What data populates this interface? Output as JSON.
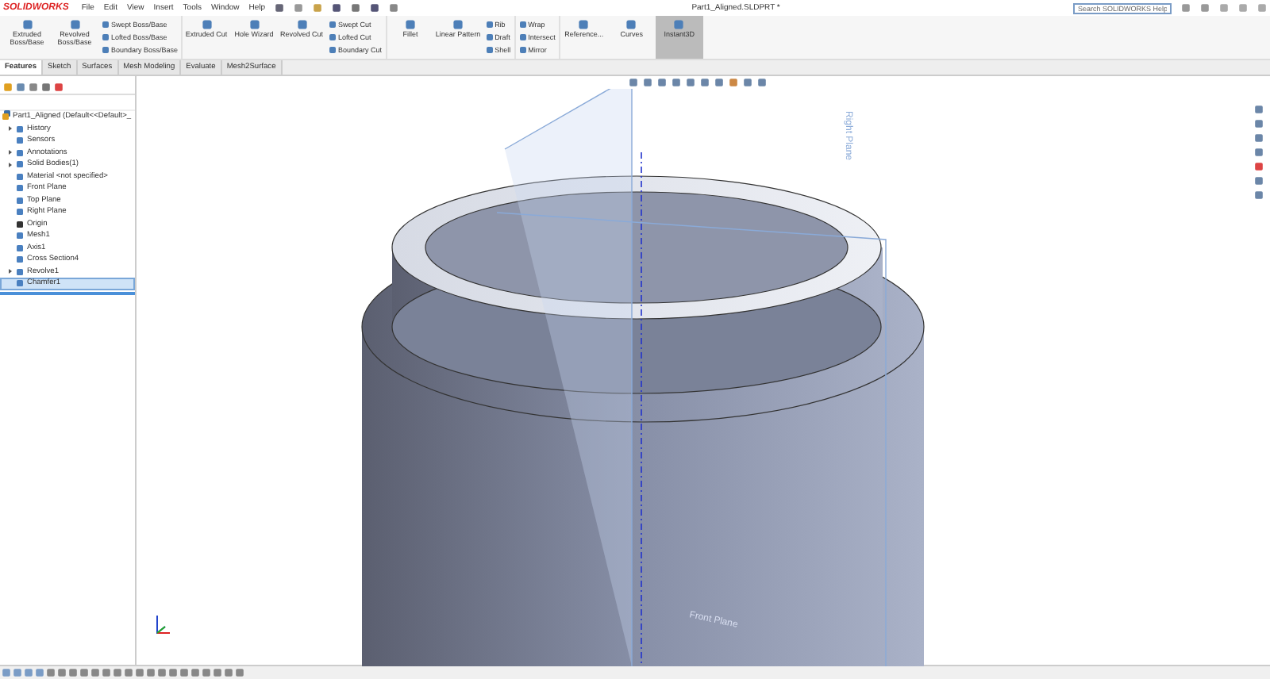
{
  "app": {
    "logo": "SOLIDWORKS"
  },
  "menu": [
    "File",
    "Edit",
    "View",
    "Insert",
    "Tools",
    "Window",
    "Help"
  ],
  "window": {
    "title": "Part1_Aligned.SLDPRT *"
  },
  "search": {
    "placeholder": "Search SOLIDWORKS Help"
  },
  "ribbon": [
    {
      "kind": "large",
      "label": "Extruded Boss/Base",
      "selected": false
    },
    {
      "kind": "large",
      "label": "Revolved Boss/Base",
      "selected": false
    },
    {
      "kind": "stack",
      "items": [
        "Swept Boss/Base",
        "Lofted Boss/Base",
        "Boundary Boss/Base"
      ]
    },
    {
      "kind": "large",
      "label": "Extruded Cut",
      "selected": false
    },
    {
      "kind": "large",
      "label": "Hole Wizard",
      "selected": false
    },
    {
      "kind": "large",
      "label": "Revolved Cut",
      "selected": false
    },
    {
      "kind": "stack",
      "items": [
        "Swept Cut",
        "Lofted Cut",
        "Boundary Cut"
      ]
    },
    {
      "kind": "large",
      "label": "Fillet",
      "selected": false
    },
    {
      "kind": "large",
      "label": "Linear Pattern",
      "selected": false
    },
    {
      "kind": "stack",
      "items": [
        "Rib",
        "Draft",
        "Shell"
      ]
    },
    {
      "kind": "stack",
      "items": [
        "Wrap",
        "Intersect",
        "Mirror"
      ]
    },
    {
      "kind": "large",
      "label": "Reference...",
      "selected": false
    },
    {
      "kind": "large",
      "label": "Curves",
      "selected": false
    },
    {
      "kind": "large",
      "label": "Instant3D",
      "selected": true
    }
  ],
  "tabs": [
    {
      "label": "Features",
      "selected": true
    },
    {
      "label": "Sketch",
      "selected": false
    },
    {
      "label": "Surfaces",
      "selected": false
    },
    {
      "label": "Mesh Modeling",
      "selected": false
    },
    {
      "label": "Evaluate",
      "selected": false
    },
    {
      "label": "Mesh2Surface",
      "selected": false
    }
  ],
  "tree": {
    "label": "Part1_Aligned  (Default<<Default>_",
    "children": [
      {
        "label": "History",
        "expander": true,
        "selected": false
      },
      {
        "label": "Sensors",
        "expander": false,
        "selected": false
      },
      {
        "label": "Annotations",
        "expander": true,
        "selected": false
      },
      {
        "label": "Solid Bodies(1)",
        "expander": true,
        "selected": false
      },
      {
        "label": "Material <not specified>",
        "expander": false,
        "selected": false
      },
      {
        "label": "Front Plane",
        "expander": false,
        "selected": false
      },
      {
        "label": "Top Plane",
        "expander": false,
        "selected": false
      },
      {
        "label": "Right Plane",
        "expander": false,
        "selected": false
      },
      {
        "label": "Origin",
        "expander": false,
        "selected": false
      },
      {
        "label": "Mesh1",
        "expander": false,
        "selected": false
      },
      {
        "label": "Axis1",
        "expander": false,
        "selected": false
      },
      {
        "label": "Cross Section4",
        "expander": false,
        "selected": false
      },
      {
        "label": "Revolve1",
        "expander": true,
        "selected": false
      },
      {
        "label": "Chamfer1",
        "expander": false,
        "selected": true
      }
    ]
  },
  "viewport": {
    "planes": [
      "Right Plane",
      "Front Plane"
    ]
  }
}
